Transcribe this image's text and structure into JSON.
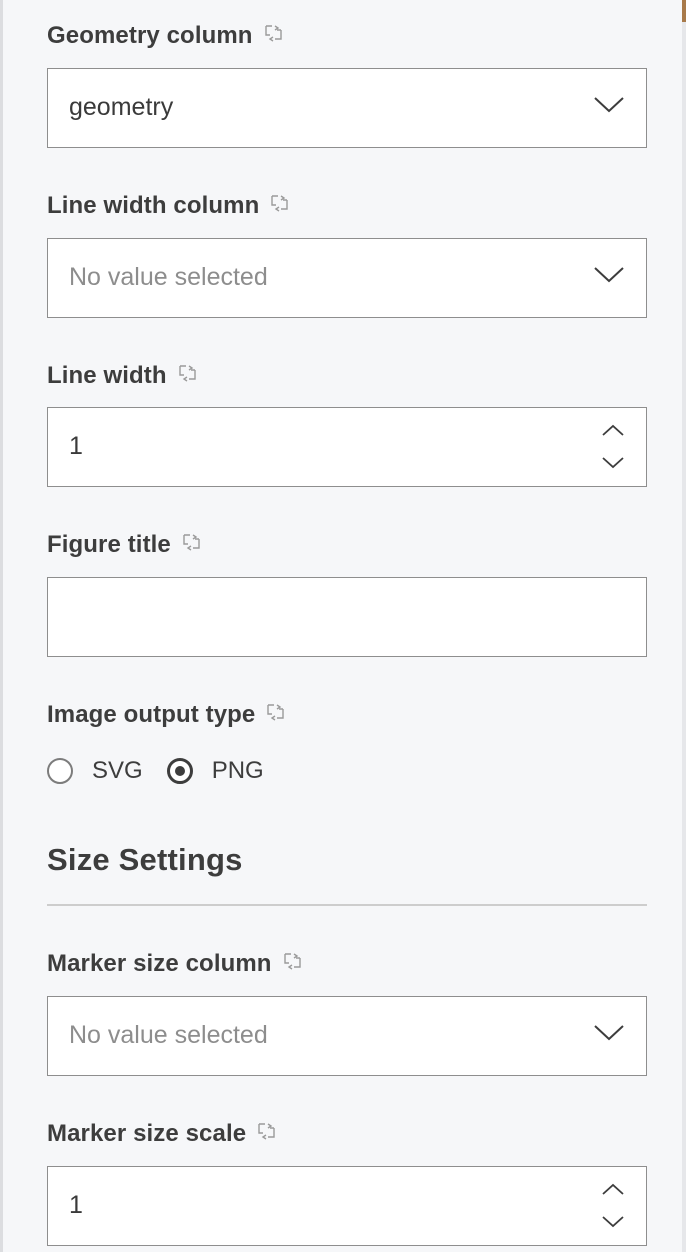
{
  "fields": {
    "geometry_column": {
      "label": "Geometry column",
      "value": "geometry"
    },
    "line_width_column": {
      "label": "Line width column",
      "placeholder": "No value selected"
    },
    "line_width": {
      "label": "Line width",
      "value": "1"
    },
    "figure_title": {
      "label": "Figure title",
      "value": ""
    },
    "image_output_type": {
      "label": "Image output type",
      "options": [
        {
          "label": "SVG",
          "selected": false
        },
        {
          "label": "PNG",
          "selected": true
        }
      ]
    }
  },
  "size_settings": {
    "title": "Size Settings",
    "marker_size_column": {
      "label": "Marker size column",
      "placeholder": "No value selected"
    },
    "marker_size_scale": {
      "label": "Marker size scale",
      "value": "1"
    }
  },
  "icons": {
    "flow_variable": "flow-variable-icon",
    "dropdown": "chevron-down-icon",
    "increment": "chevron-up-icon",
    "decrement": "chevron-down-icon"
  },
  "colors": {
    "panel_background": "#f6f7f9",
    "text": "#3d3d3d",
    "border": "#8e8e8e",
    "placeholder": "#8d8d8d"
  }
}
